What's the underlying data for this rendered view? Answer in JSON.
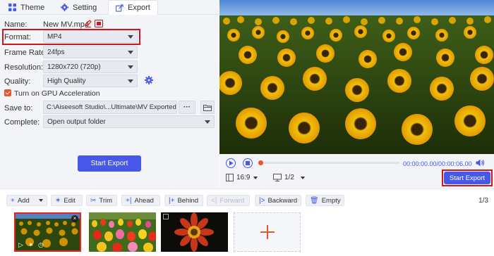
{
  "tabs": [
    {
      "label": "Theme",
      "icon": "theme-grid-icon"
    },
    {
      "label": "Setting",
      "icon": "gear-icon"
    },
    {
      "label": "Export",
      "icon": "export-icon",
      "active": true
    }
  ],
  "form": {
    "name_label": "Name:",
    "name_value": "New MV.mp4",
    "format_label": "Format:",
    "format_value": "MP4",
    "framerate_label": "Frame Rate:",
    "framerate_value": "24fps",
    "resolution_label": "Resolution:",
    "resolution_value": "1280x720 (720p)",
    "quality_label": "Quality:",
    "quality_value": "High Quality",
    "gpu_label": "Turn on GPU Acceleration",
    "gpu_checked": true,
    "saveto_label": "Save to:",
    "saveto_value": "C:\\Aiseesoft Studio\\...Ultimate\\MV Exported",
    "saveto_more": "···",
    "complete_label": "Complete:",
    "complete_value": "Open output folder",
    "start_export_label": "Start Export"
  },
  "player": {
    "time": "00:00:00.00/00:00:06.00",
    "aspect": "16:9",
    "page": "1/2",
    "start_export_label": "Start Export"
  },
  "toolbar": {
    "add": "Add",
    "edit": "Edit",
    "trim": "Trim",
    "ahead": "Ahead",
    "behind": "Behind",
    "forward": "Forward",
    "backward": "Backward",
    "empty": "Empty",
    "page_count": "1/3"
  },
  "timeline": {
    "clips": [
      {
        "name": "sunflower-field-clip",
        "selected": true
      },
      {
        "name": "tulip-field-clip",
        "selected": false
      },
      {
        "name": "red-flower-closeup-clip",
        "selected": false
      }
    ]
  },
  "colors": {
    "accent": "#4757e8",
    "highlight_red": "#d0161b",
    "checkbox_orange": "#e2582c"
  }
}
